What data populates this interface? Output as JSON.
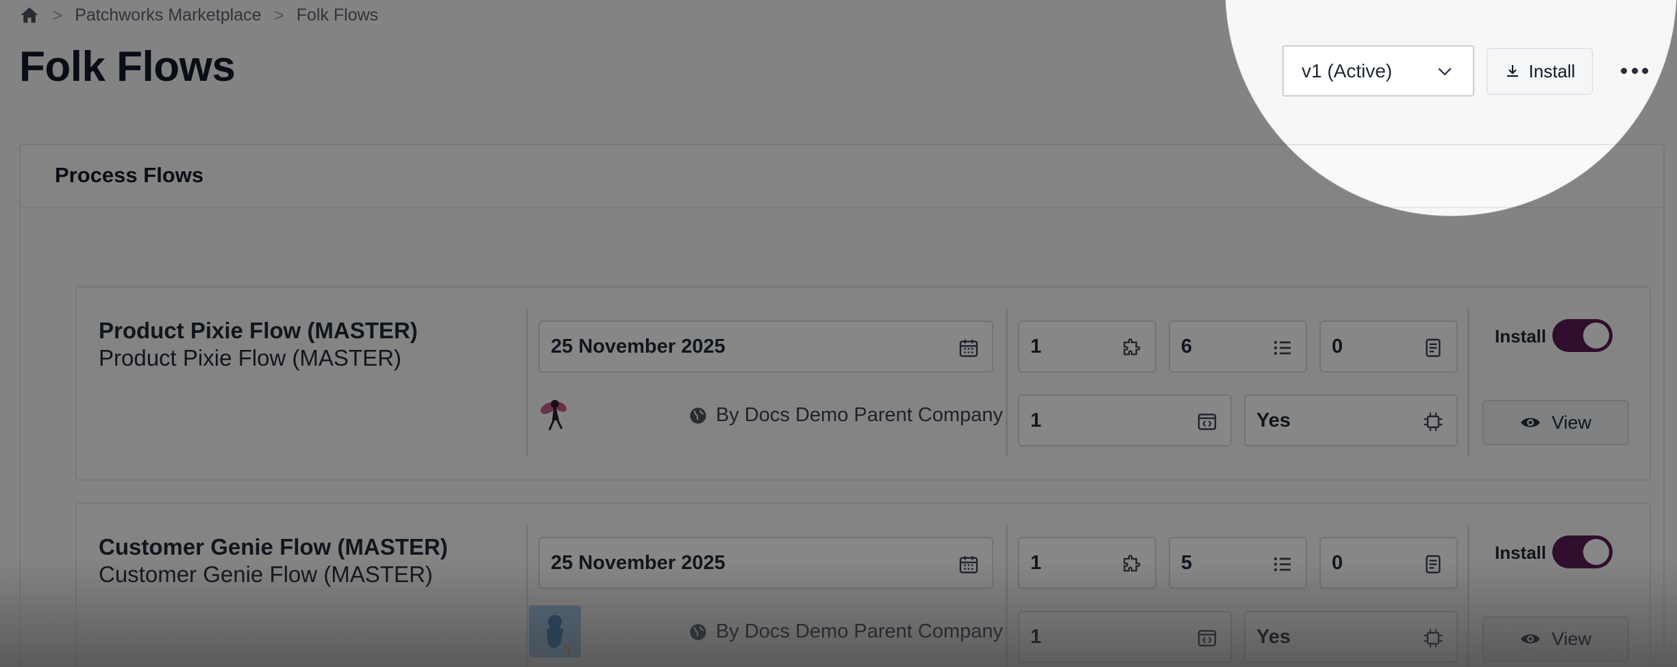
{
  "breadcrumb": {
    "items": [
      "Patchworks Marketplace",
      "Folk Flows"
    ],
    "separator": ">"
  },
  "page_title": "Folk Flows",
  "header": {
    "version_select": "v1 (Active)",
    "install_button": "Install"
  },
  "section": {
    "title": "Process Flows"
  },
  "flows": [
    {
      "name": "Product Pixie Flow (MASTER)",
      "subtitle": "Product Pixie Flow (MASTER)",
      "date": "25 November 2025",
      "byline": "By Docs Demo Parent Company",
      "stats": {
        "connectors": "1",
        "steps": "6",
        "docs": "0",
        "scripts": "1",
        "cache": "Yes"
      },
      "install_label": "Install",
      "install_enabled": true,
      "view_label": "View"
    },
    {
      "name": "Customer Genie Flow (MASTER)",
      "subtitle": "Customer Genie Flow (MASTER)",
      "date": "25 November 2025",
      "byline": "By Docs Demo Parent Company",
      "stats": {
        "connectors": "1",
        "steps": "5",
        "docs": "0",
        "scripts": "1",
        "cache": "Yes"
      },
      "install_label": "Install",
      "install_enabled": true,
      "view_label": "View"
    }
  ],
  "colors": {
    "toggle_on": "#5a1a55",
    "overlay": "rgba(0,0,0,0.47)"
  }
}
